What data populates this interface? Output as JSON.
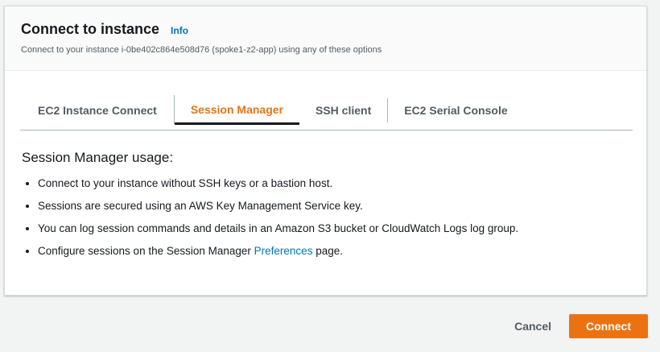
{
  "header": {
    "title": "Connect to instance",
    "info_label": "Info",
    "subtitle": "Connect to your instance i-0be402c864e508d76 (spoke1-z2-app) using any of these options"
  },
  "tabs": [
    {
      "label": "EC2 Instance Connect",
      "active": false
    },
    {
      "label": "Session Manager",
      "active": true
    },
    {
      "label": "SSH client",
      "active": false
    },
    {
      "label": "EC2 Serial Console",
      "active": false
    }
  ],
  "content": {
    "heading": "Session Manager usage:",
    "bullets": [
      "Connect to your instance without SSH keys or a bastion host.",
      "Sessions are secured using an AWS Key Management Service key.",
      "You can log session commands and details in an Amazon S3 bucket or CloudWatch Logs log group."
    ],
    "last_bullet": {
      "prefix": "Configure sessions on the Session Manager ",
      "link": "Preferences",
      "suffix": " page."
    }
  },
  "footer": {
    "cancel_label": "Cancel",
    "connect_label": "Connect"
  },
  "colors": {
    "accent": "#ec7211",
    "link": "#0073bb",
    "text": "#16191f",
    "muted": "#545b64"
  }
}
